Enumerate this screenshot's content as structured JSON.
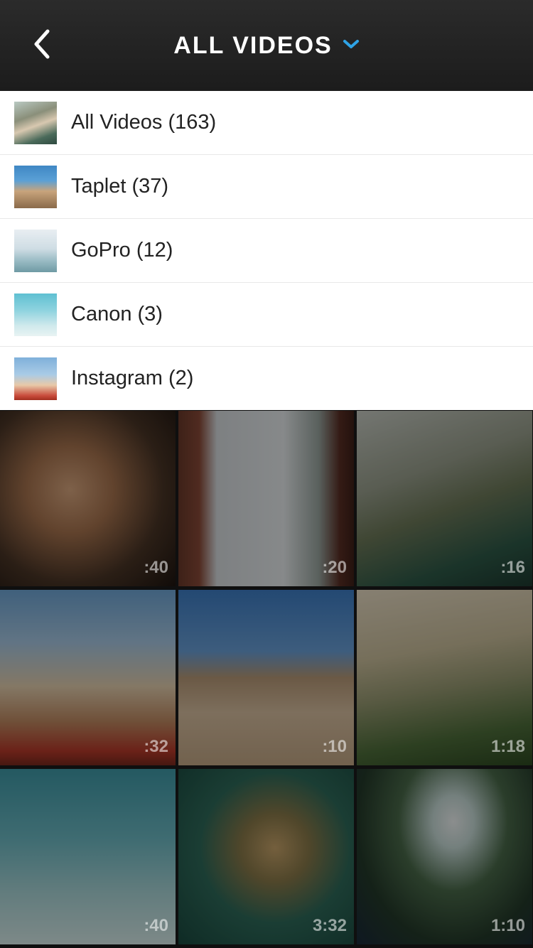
{
  "header": {
    "title": "ALL VIDEOS",
    "back_icon": "chevron-left-icon",
    "dropdown_icon": "chevron-down-icon",
    "accent": "#2fa3e6"
  },
  "albums": [
    {
      "label": "All Videos (163)",
      "thumb": "thumb-river"
    },
    {
      "label": "Taplet (37)",
      "thumb": "thumb-beach"
    },
    {
      "label": "GoPro (12)",
      "thumb": "thumb-surf"
    },
    {
      "label": "Canon (3)",
      "thumb": "thumb-underwater"
    },
    {
      "label": "Instagram (2)",
      "thumb": "thumb-surfboard"
    }
  ],
  "videos": [
    {
      "duration": ":40"
    },
    {
      "duration": ":20"
    },
    {
      "duration": ":16"
    },
    {
      "duration": ":32"
    },
    {
      "duration": ":10"
    },
    {
      "duration": "1:18"
    },
    {
      "duration": ":40"
    },
    {
      "duration": "3:32"
    },
    {
      "duration": "1:10"
    }
  ]
}
